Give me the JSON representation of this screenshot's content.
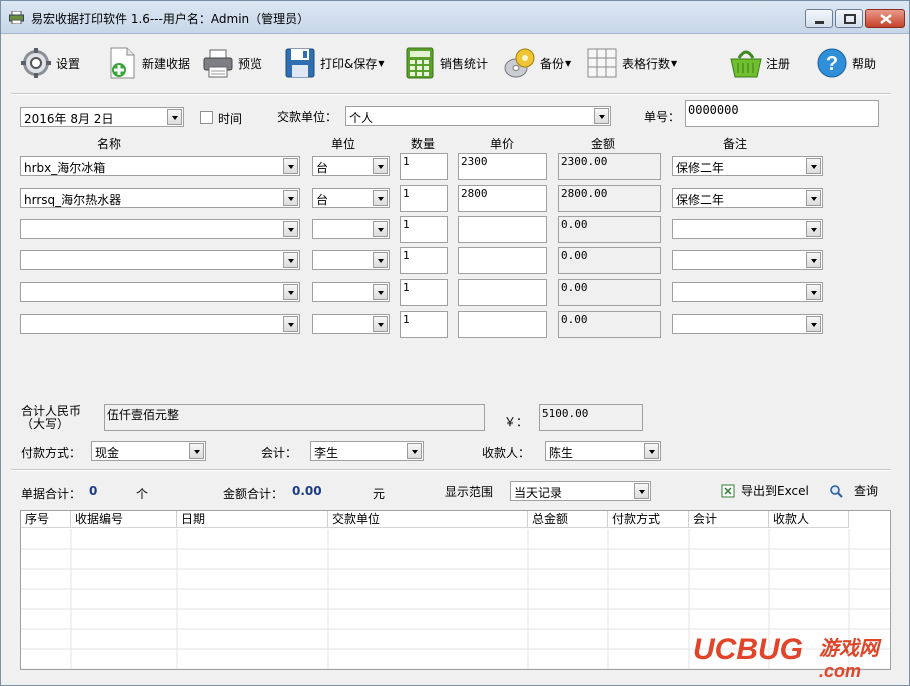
{
  "window": {
    "title": "易宏收据打印软件 1.6---用户名：Admin（管理员）"
  },
  "toolbar": {
    "settings": "设置",
    "new_receipt": "新建收据",
    "preview": "预览",
    "print_save": "打印&保存",
    "sales_stats": "销售统计",
    "backup": "备份",
    "table_rows": "表格行数",
    "register": "注册",
    "help": "帮助"
  },
  "header": {
    "date_value": "2016年  8月  2日",
    "time_label": "时间",
    "payer_label": "交款单位：",
    "payer_value": "个人",
    "number_label": "单号：",
    "number_value": "0000000"
  },
  "columns": {
    "name": "名称",
    "unit": "单位",
    "qty": "数量",
    "price": "单价",
    "amount": "金额",
    "note": "备注"
  },
  "rows": [
    {
      "name": "hrbx_海尔冰箱",
      "unit": "台",
      "qty": "1",
      "price": "2300",
      "amount": "2300.00",
      "note": "保修二年"
    },
    {
      "name": "hrrsq_海尔热水器",
      "unit": "台",
      "qty": "1",
      "price": "2800",
      "amount": "2800.00",
      "note": "保修二年"
    },
    {
      "name": "",
      "unit": "",
      "qty": "1",
      "price": "",
      "amount": "0.00",
      "note": ""
    },
    {
      "name": "",
      "unit": "",
      "qty": "1",
      "price": "",
      "amount": "0.00",
      "note": ""
    },
    {
      "name": "",
      "unit": "",
      "qty": "1",
      "price": "",
      "amount": "0.00",
      "note": ""
    },
    {
      "name": "",
      "unit": "",
      "qty": "1",
      "price": "",
      "amount": "0.00",
      "note": ""
    }
  ],
  "totals": {
    "rmb_label_line1": "合计人民币",
    "rmb_label_line2": "（大写）",
    "rmb_upper": "伍仟壹佰元整",
    "yen_label": "￥：",
    "total_value": "5100.00"
  },
  "payment": {
    "method_label": "付款方式：",
    "method_value": "现金",
    "accountant_label": "会计：",
    "accountant_value": "李生",
    "payee_label": "收款人：",
    "payee_value": "陈生"
  },
  "summary": {
    "count_label": "单据合计：",
    "count_value": "0",
    "count_unit": "个",
    "amount_label": "金额合计：",
    "amount_value": "0.00",
    "amount_unit": "元",
    "range_label": "显示范围",
    "range_value": "当天记录",
    "export_label": "导出到Excel",
    "query_label": "查询"
  },
  "grid": {
    "headers": [
      "序号",
      "收据编号",
      "日期",
      "交款单位",
      "总金额",
      "付款方式",
      "会计",
      "收款人"
    ]
  },
  "watermark": {
    "brand": "UCBUG",
    "cn": "游戏网",
    "domain": ".com"
  }
}
